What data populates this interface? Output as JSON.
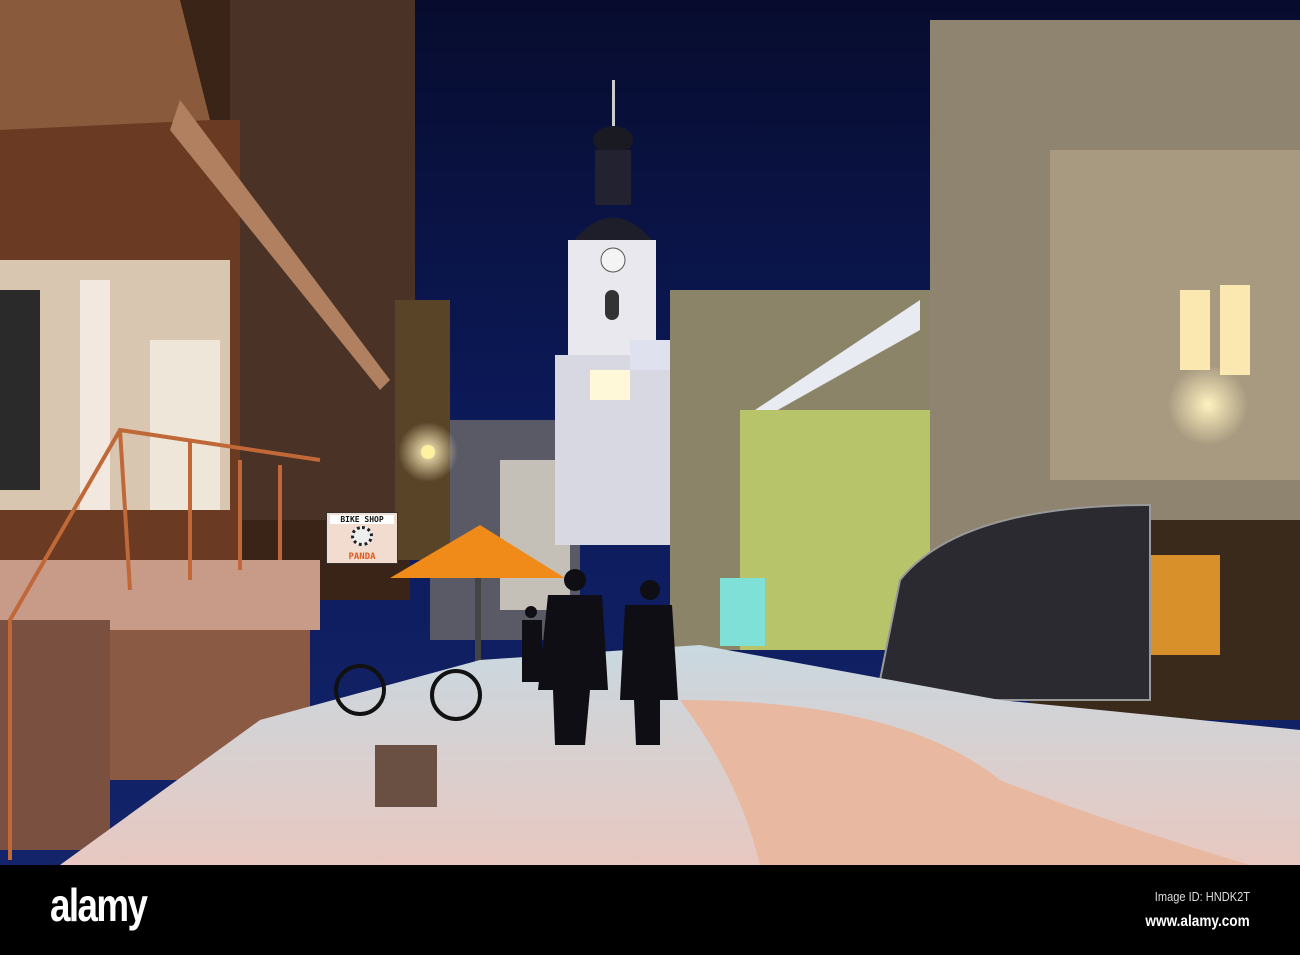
{
  "photo": {
    "shop_sign": {
      "top": "BIKE SHOP",
      "bottom": "PANDA"
    },
    "watermark": "alamy"
  },
  "footer": {
    "logo": "alamy",
    "image_id": "Image ID: HNDK2T",
    "website": "www.alamy.com"
  }
}
